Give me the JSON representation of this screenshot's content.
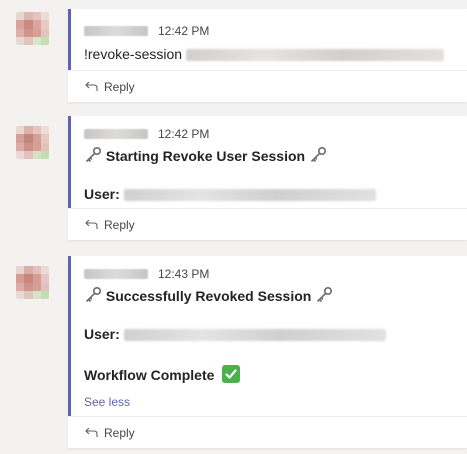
{
  "messages": [
    {
      "time": "12:42 PM",
      "text": "!revoke-session",
      "reply_label": "Reply"
    },
    {
      "time": "12:42 PM",
      "title": "Starting Revoke User Session",
      "user_label": "User:",
      "reply_label": "Reply"
    },
    {
      "time": "12:43 PM",
      "title": "Successfully Revoked Session",
      "user_label": "User:",
      "workflow_text": "Workflow Complete",
      "see_less_label": "See less",
      "reply_label": "Reply"
    }
  ],
  "colors": {
    "accent": "#6264a7",
    "background": "#f3f2f1",
    "card": "#ffffff",
    "check": "#4cb04f"
  },
  "icons": {
    "key": "key-icon",
    "check": "white-check-mark-icon",
    "reply": "reply-arrow-icon"
  }
}
